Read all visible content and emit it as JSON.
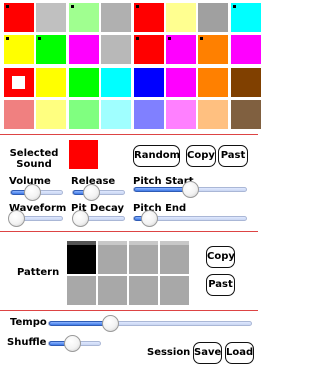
{
  "palette": {
    "rows": [
      [
        {
          "color": "#ff0000",
          "marker": "dot"
        },
        {
          "color": "#c0c0c0",
          "marker": "none"
        },
        {
          "color": "#a0ff90",
          "marker": "dot"
        },
        {
          "color": "#b0b0b0",
          "marker": "none"
        },
        {
          "color": "#ff0000",
          "marker": "dot"
        },
        {
          "color": "#ffff90",
          "marker": "none"
        },
        {
          "color": "#a0a0a0",
          "marker": "none"
        },
        {
          "color": "#00ffff",
          "marker": "dot"
        }
      ],
      [
        {
          "color": "#ffff00",
          "marker": "dot"
        },
        {
          "color": "#00ff00",
          "marker": "dot"
        },
        {
          "color": "#ff00ff",
          "marker": "none"
        },
        {
          "color": "#b8b8b8",
          "marker": "none"
        },
        {
          "color": "#ff0000",
          "marker": "dot"
        },
        {
          "color": "#ff00ff",
          "marker": "dot"
        },
        {
          "color": "#ff8000",
          "marker": "dot"
        },
        {
          "color": "#ff00ff",
          "marker": "none"
        }
      ],
      [
        {
          "color": "#ff0000",
          "marker": "square"
        },
        {
          "color": "#ffff00",
          "marker": "none"
        },
        {
          "color": "#00ff00",
          "marker": "none"
        },
        {
          "color": "#00ffff",
          "marker": "none"
        },
        {
          "color": "#0000ff",
          "marker": "none"
        },
        {
          "color": "#ff00ff",
          "marker": "none"
        },
        {
          "color": "#ff8000",
          "marker": "none"
        },
        {
          "color": "#804000",
          "marker": "none"
        }
      ],
      [
        {
          "color": "#f08080",
          "marker": "none"
        },
        {
          "color": "#ffff80",
          "marker": "none"
        },
        {
          "color": "#80ff80",
          "marker": "none"
        },
        {
          "color": "#a0ffff",
          "marker": "none"
        },
        {
          "color": "#8080ff",
          "marker": "none"
        },
        {
          "color": "#ff80ff",
          "marker": "none"
        },
        {
          "color": "#ffc080",
          "marker": "none"
        },
        {
          "color": "#806040",
          "marker": "none"
        }
      ]
    ]
  },
  "selected_sound": {
    "label": "Selected Sound",
    "swatch_color": "#ff0000"
  },
  "buttons": {
    "random": "Random",
    "copy": "Copy",
    "paste": "Past",
    "pattern_copy": "Copy",
    "pattern_paste": "Past",
    "save": "Save",
    "load": "Load"
  },
  "sliders": {
    "volume": {
      "label": "Volume",
      "value": 0.42
    },
    "release": {
      "label": "Release",
      "value": 0.35
    },
    "pitch_start": {
      "label": "Pitch Start",
      "value": 0.5
    },
    "waveform": {
      "label": "Waveform",
      "value": 0.1
    },
    "pitch_decay": {
      "label": "Pit Decay",
      "value": 0.13
    },
    "pitch_end": {
      "label": "Pitch End",
      "value": 0.13
    },
    "tempo": {
      "label": "Tempo",
      "value": 0.3
    },
    "shuffle": {
      "label": "Shuffle",
      "value": 0.45
    }
  },
  "pattern": {
    "label": "Pattern",
    "cells": [
      [
        true,
        false,
        false,
        false
      ],
      [
        false,
        false,
        false,
        false
      ]
    ],
    "active_color": "#000000",
    "inactive_color": "#a8a8a8"
  },
  "session": {
    "label": "Session"
  },
  "colors": {
    "divider": "#dd4444",
    "slider_fill": "#3f79e6"
  }
}
